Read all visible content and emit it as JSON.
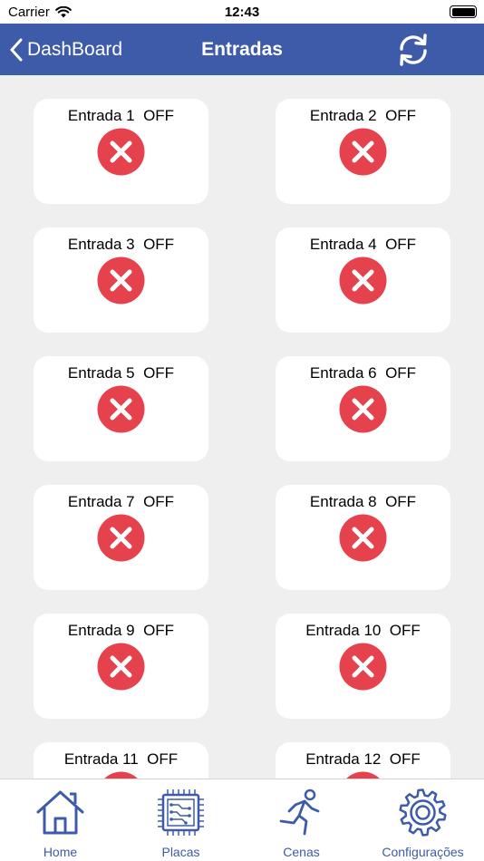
{
  "status_bar": {
    "carrier": "Carrier",
    "time": "12:43"
  },
  "nav": {
    "back_label": "DashBoard",
    "title": "Entradas"
  },
  "inputs": [
    {
      "label": "Entrada 1  OFF",
      "state": "OFF"
    },
    {
      "label": "Entrada 2  OFF",
      "state": "OFF"
    },
    {
      "label": "Entrada 3  OFF",
      "state": "OFF"
    },
    {
      "label": "Entrada 4  OFF",
      "state": "OFF"
    },
    {
      "label": "Entrada 5  OFF",
      "state": "OFF"
    },
    {
      "label": "Entrada 6  OFF",
      "state": "OFF"
    },
    {
      "label": "Entrada 7  OFF",
      "state": "OFF"
    },
    {
      "label": "Entrada 8  OFF",
      "state": "OFF"
    },
    {
      "label": "Entrada 9  OFF",
      "state": "OFF"
    },
    {
      "label": "Entrada 10  OFF",
      "state": "OFF"
    },
    {
      "label": "Entrada 11  OFF",
      "state": "OFF"
    },
    {
      "label": "Entrada 12  OFF",
      "state": "OFF"
    }
  ],
  "tab_bar": {
    "tabs": [
      {
        "label": "Home",
        "icon": "home-icon"
      },
      {
        "label": "Placas",
        "icon": "chip-icon"
      },
      {
        "label": "Cenas",
        "icon": "running-person-icon"
      },
      {
        "label": "Configurações",
        "icon": "gear-icon"
      }
    ]
  },
  "colors": {
    "accent": "#3e5ba9",
    "off_red": "#e5424d",
    "background": "#efefef",
    "card": "#ffffff"
  }
}
